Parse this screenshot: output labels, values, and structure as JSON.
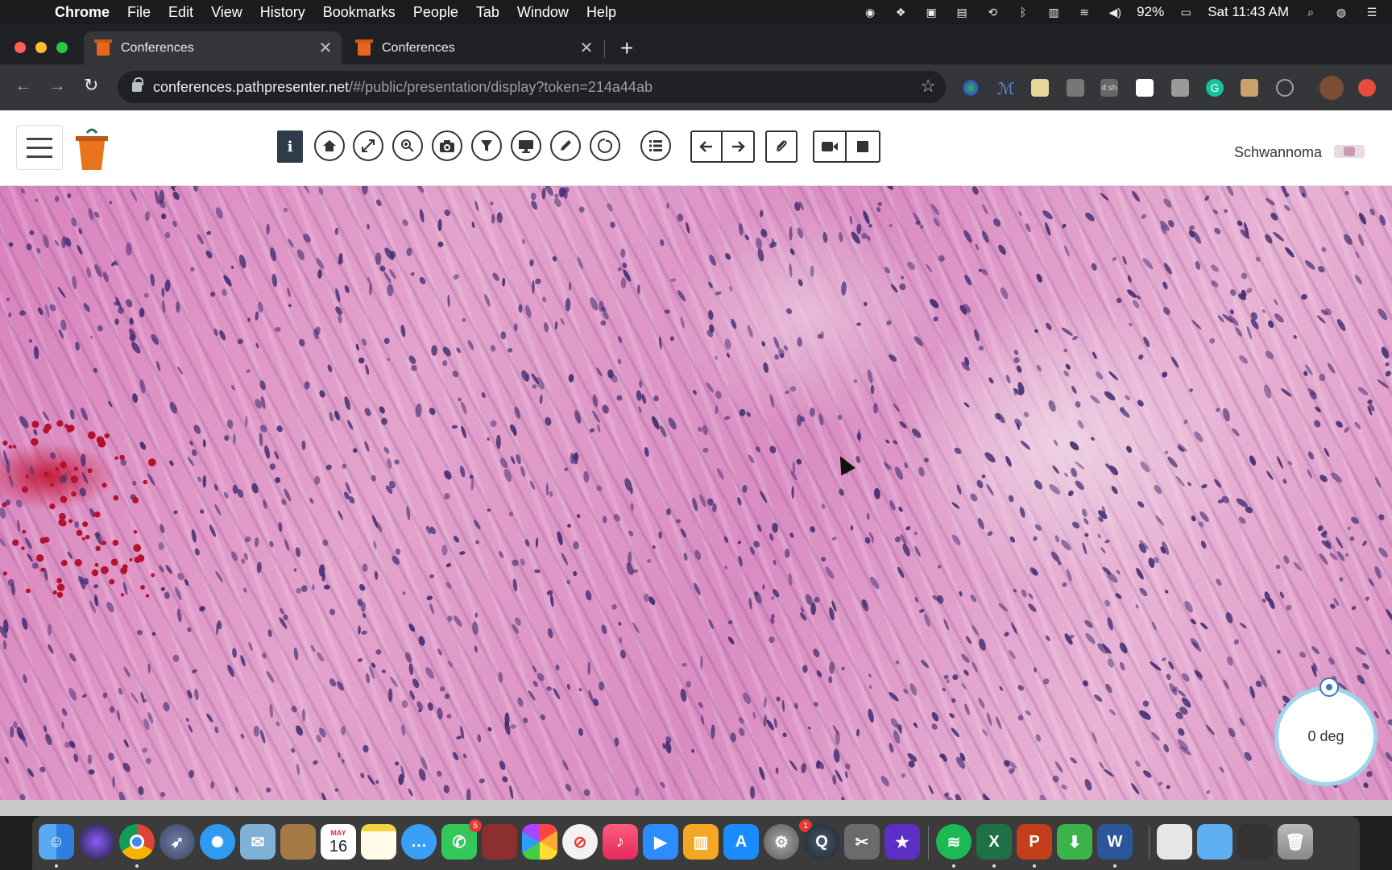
{
  "menubar": {
    "app_name": "Chrome",
    "items": [
      "File",
      "Edit",
      "View",
      "History",
      "Bookmarks",
      "People",
      "Tab",
      "Window",
      "Help"
    ],
    "battery": "92%",
    "clock": "Sat 11:43 AM"
  },
  "tabs": [
    {
      "title": "Conferences",
      "active": true
    },
    {
      "title": "Conferences",
      "active": false
    }
  ],
  "address_bar": {
    "host": "conferences.pathpresenter.net",
    "path": "/#/public/presentation/display?token=214a44ab"
  },
  "viewer_header": {
    "info_label": "i",
    "case_title": "Schwannoma"
  },
  "toolbar_icons": [
    "home-icon",
    "fullscreen-icon",
    "zoom-icon",
    "camera-icon",
    "filter-icon",
    "monitor-icon",
    "pencil-icon",
    "circle-draw-icon",
    "list-icon",
    "arrow-left-icon",
    "arrow-right-icon",
    "attachment-icon",
    "video-icon",
    "stop-icon"
  ],
  "rotation": {
    "label": "0 deg",
    "angle_deg": 0
  },
  "dock": {
    "calendar_month": "MAY",
    "calendar_day": "16",
    "messages_badge": "5",
    "settings_badge": "1"
  },
  "colors": {
    "stain_pink": "#d98cc2",
    "nuclei": "#3d2a6e",
    "info_button": "#2e3b4a",
    "dial_border": "#9fd4ea"
  }
}
